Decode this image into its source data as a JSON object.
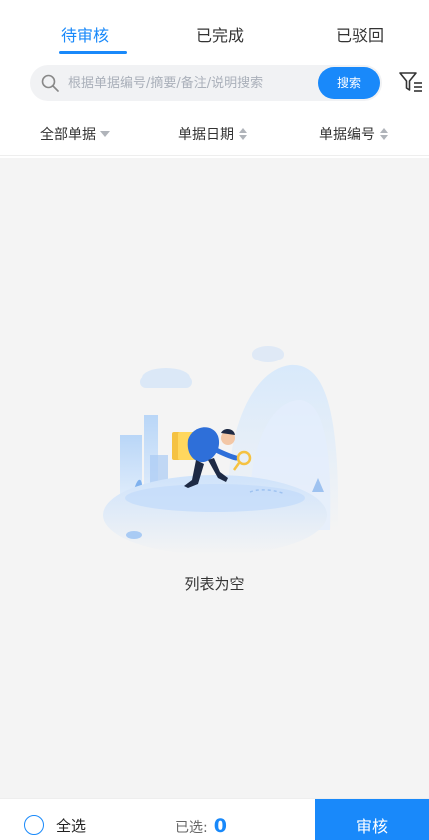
{
  "tabs": [
    {
      "label": "待审核",
      "active": true
    },
    {
      "label": "已完成",
      "active": false
    },
    {
      "label": "已驳回",
      "active": false
    }
  ],
  "search": {
    "placeholder": "根据单据编号/摘要/备注/说明搜索",
    "button_label": "搜索",
    "icon": "search-icon"
  },
  "filter": {
    "icon": "filter-icon"
  },
  "sort_bar": {
    "all_docs": "全部单据",
    "doc_date": "单据日期",
    "doc_number": "单据编号"
  },
  "empty": {
    "text": "列表为空"
  },
  "footer": {
    "select_all": "全选",
    "selected_label": "已选:",
    "selected_count": "0",
    "approve_button": "审核"
  },
  "colors": {
    "accent": "#1989fa",
    "background": "#f4f4f4"
  }
}
